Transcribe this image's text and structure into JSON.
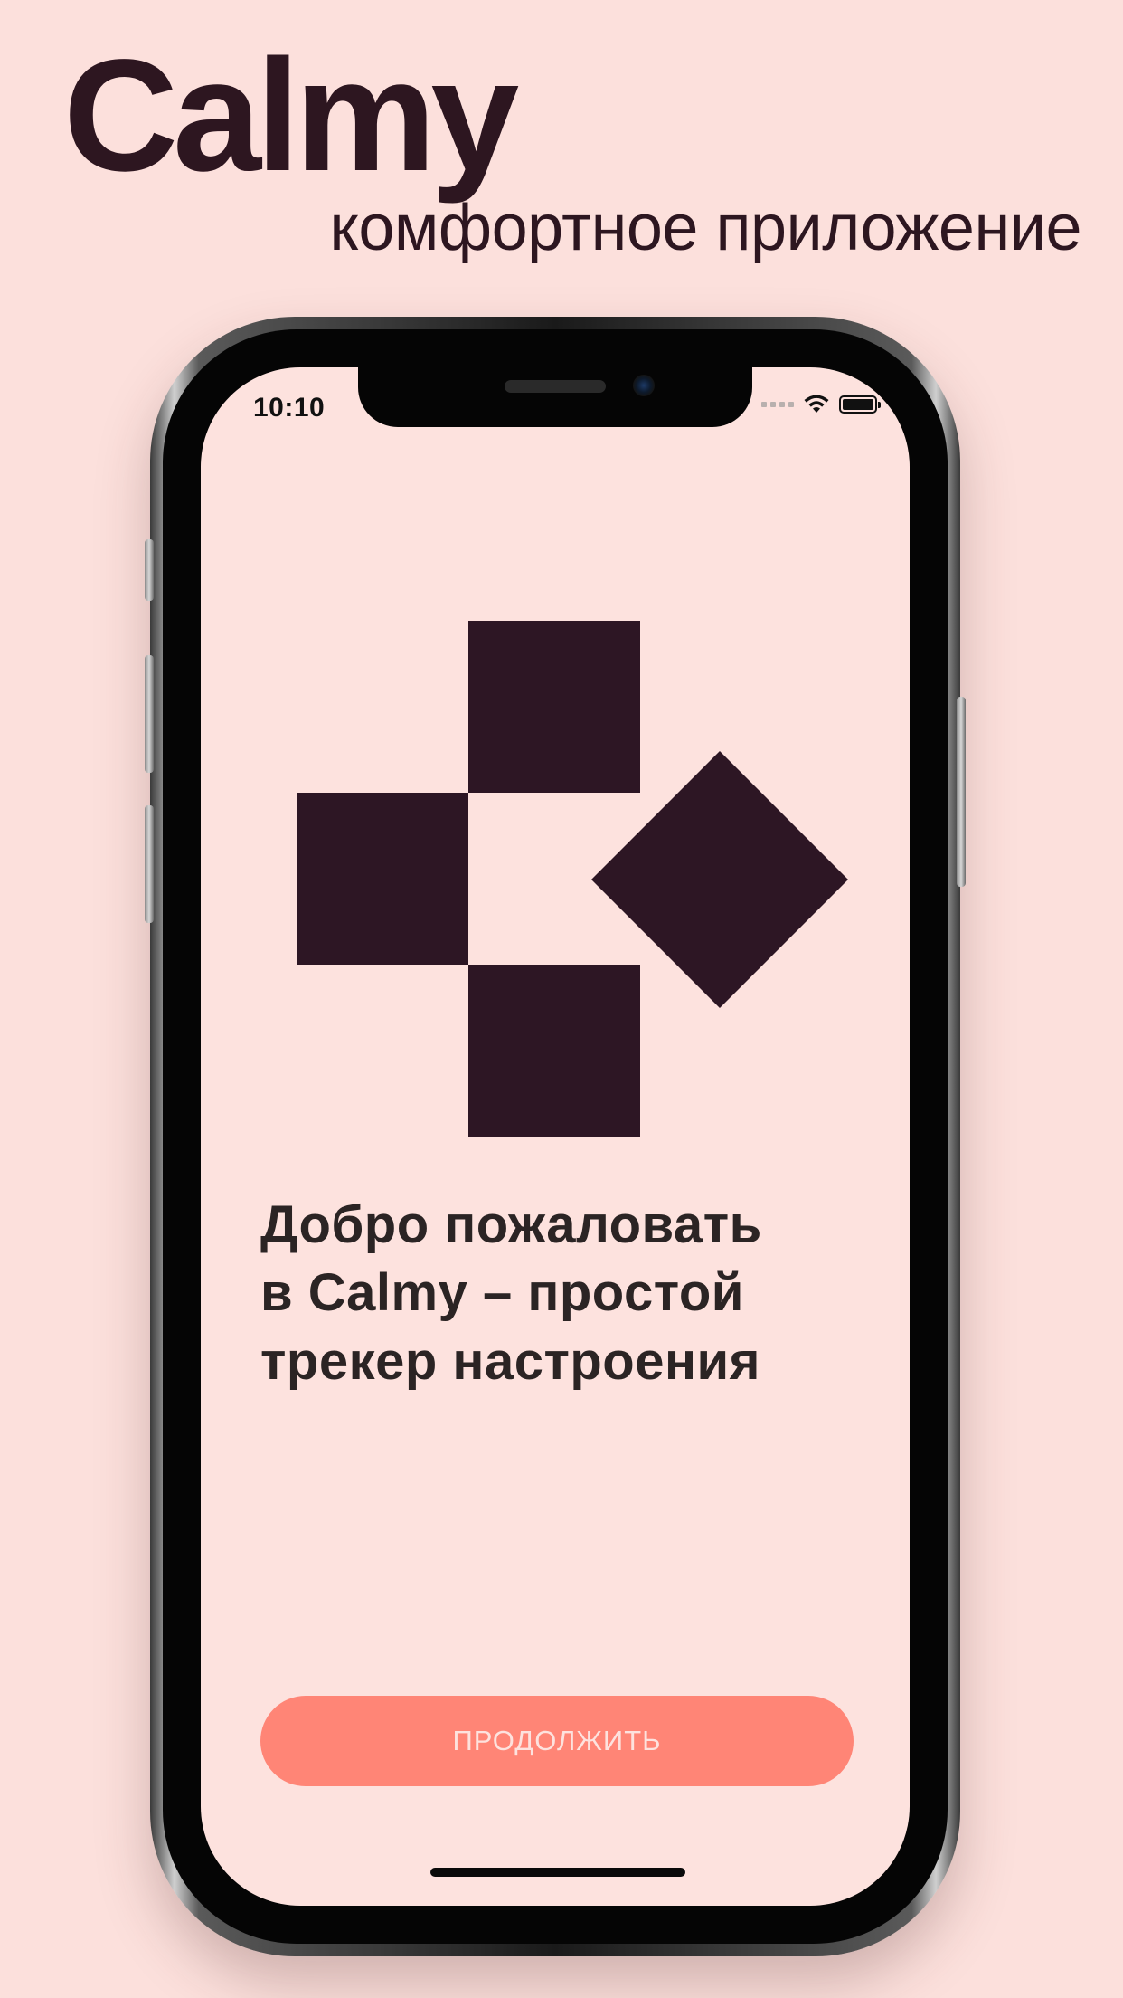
{
  "promo": {
    "app_name": "Calmy",
    "tagline": "комфортное приложение"
  },
  "status_bar": {
    "time": "10:10",
    "icons": [
      "cellular-signal-icon",
      "wifi-icon",
      "battery-icon"
    ]
  },
  "screen": {
    "logo_icon": "calmy-logo-icon",
    "welcome_lines": [
      "Добро пожаловать",
      "в Calmy – простой",
      "трекер настроения"
    ],
    "continue_label": "ПРОДОЛЖИТЬ"
  },
  "colors": {
    "background": "#fce0dc",
    "screen_background": "#fde2de",
    "logo": "#2d1624",
    "button": "#ff8576",
    "heading_text": "#2b2424"
  }
}
